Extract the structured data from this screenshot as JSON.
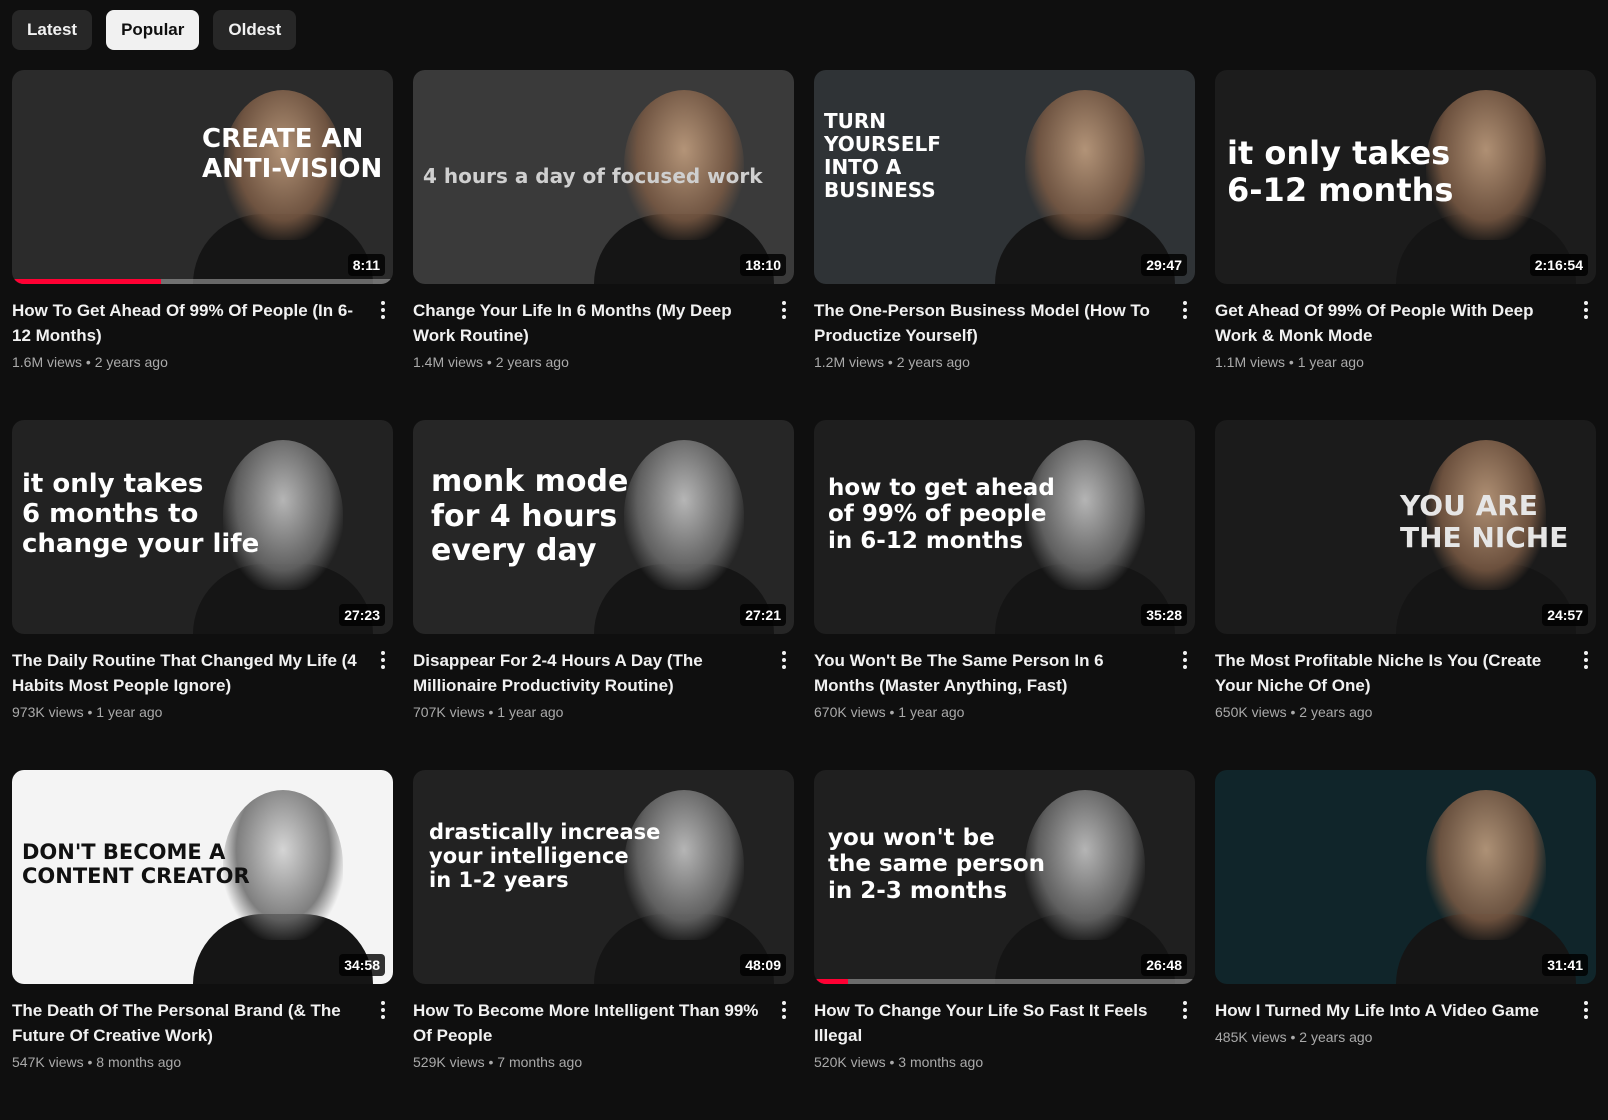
{
  "chips": [
    {
      "label": "Latest",
      "active": false
    },
    {
      "label": "Popular",
      "active": true
    },
    {
      "label": "Oldest",
      "active": false
    }
  ],
  "videos": [
    {
      "title": "How To Get Ahead Of 99% Of People (In 6-12 Months)",
      "views": "1.6M views",
      "age": "2 years ago",
      "duration": "8:11",
      "thumb_text": "CREATE AN\nANTI-VISION",
      "thumb_bg": "#2b2b2b",
      "text_color": "#ffffff",
      "progress": 0.39,
      "tone": "color"
    },
    {
      "title": "Change Your Life In 6 Months (My Deep Work Routine)",
      "views": "1.4M views",
      "age": "2 years ago",
      "duration": "18:10",
      "thumb_text": "4 hours a day      of focused work",
      "thumb_bg": "#3a3a3a",
      "text_color": "#cfcfcf",
      "progress": 0,
      "tone": "color"
    },
    {
      "title": "The One-Person Business Model (How To Productize Yourself)",
      "views": "1.2M views",
      "age": "2 years ago",
      "duration": "29:47",
      "thumb_text": "TURN\nYOURSELF\nINTO A\nBUSINESS",
      "thumb_bg": "#2f3336",
      "text_color": "#ffffff",
      "progress": 0,
      "tone": "color"
    },
    {
      "title": "Get Ahead Of 99% Of People With Deep Work & Monk Mode",
      "views": "1.1M views",
      "age": "1 year ago",
      "duration": "2:16:54",
      "thumb_text": "it only takes\n6-12 months",
      "thumb_bg": "#1c1c1c",
      "text_color": "#ffffff",
      "progress": 0,
      "tone": "color"
    },
    {
      "title": "The Daily Routine That Changed My Life (4 Habits Most People Ignore)",
      "views": "973K views",
      "age": "1 year ago",
      "duration": "27:23",
      "thumb_text": "it only takes\n6 months to\nchange your life",
      "thumb_bg": "#222222",
      "text_color": "#ffffff",
      "progress": 0,
      "tone": "bw"
    },
    {
      "title": "Disappear For 2-4 Hours A Day (The Millionaire Productivity Routine)",
      "views": "707K views",
      "age": "1 year ago",
      "duration": "27:21",
      "thumb_text": "monk mode\nfor 4 hours\nevery day",
      "thumb_bg": "#262626",
      "text_color": "#ffffff",
      "progress": 0,
      "tone": "bw"
    },
    {
      "title": "You Won't Be The Same Person In 6 Months (Master Anything, Fast)",
      "views": "670K views",
      "age": "1 year ago",
      "duration": "35:28",
      "thumb_text": "how to get ahead\nof 99% of people\nin 6-12 months",
      "thumb_bg": "#1e1e1e",
      "text_color": "#ffffff",
      "progress": 0,
      "tone": "bw"
    },
    {
      "title": "The Most Profitable Niche Is You (Create Your Niche Of One)",
      "views": "650K views",
      "age": "2 years ago",
      "duration": "24:57",
      "thumb_text": "YOU ARE\nTHE NICHE",
      "thumb_bg": "#1b1b1b",
      "text_color": "#e6e6e6",
      "progress": 0,
      "tone": "color"
    },
    {
      "title": "The Death Of The Personal Brand (& The Future Of Creative Work)",
      "views": "547K views",
      "age": "8 months ago",
      "duration": "34:58",
      "thumb_text": "DON'T BECOME A\nCONTENT CREATOR",
      "thumb_bg": "#f4f4f4",
      "text_color": "#111111",
      "progress": 0,
      "tone": "bw"
    },
    {
      "title": "How To Become More Intelligent Than 99% Of People",
      "views": "529K views",
      "age": "7 months ago",
      "duration": "48:09",
      "thumb_text": "drastically increase\nyour intelligence\nin 1-2 years",
      "thumb_bg": "#222222",
      "text_color": "#ffffff",
      "progress": 0,
      "tone": "bw"
    },
    {
      "title": "How To Change Your Life So Fast It Feels Illegal",
      "views": "520K views",
      "age": "3 months ago",
      "duration": "26:48",
      "thumb_text": "you won't be\nthe same person\nin 2-3 months",
      "thumb_bg": "#1f1f1f",
      "text_color": "#ffffff",
      "progress": 0.09,
      "tone": "bw"
    },
    {
      "title": "How I Turned My Life Into A Video Game",
      "views": "485K views",
      "age": "2 years ago",
      "duration": "31:41",
      "thumb_text": "",
      "thumb_bg": "#10252a",
      "text_color": "#ffffff",
      "progress": 0,
      "tone": "color"
    }
  ]
}
